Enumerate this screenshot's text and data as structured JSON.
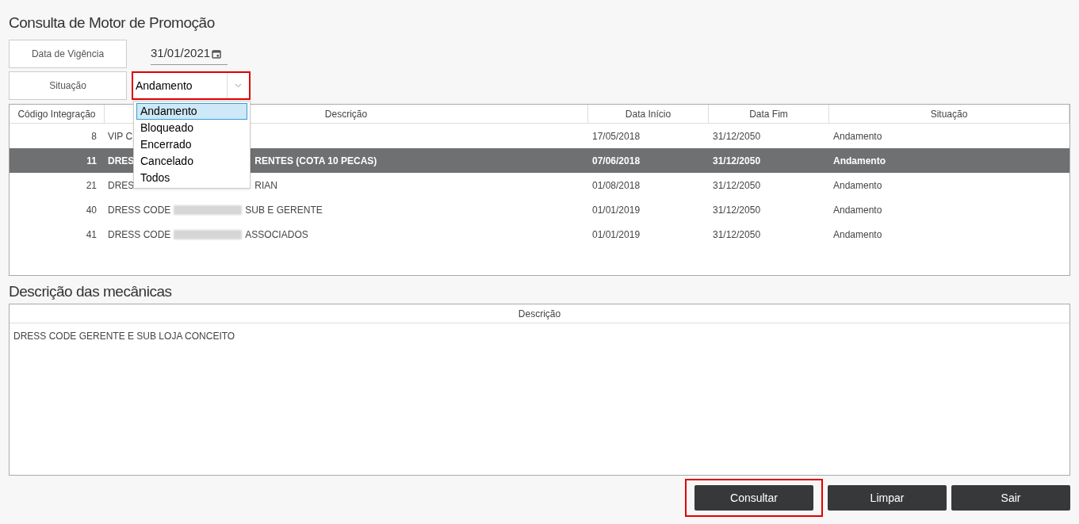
{
  "title": "Consulta de Motor de Promoção",
  "filters": {
    "date_label": "Data de Vigência",
    "date_value": "31/01/2021",
    "status_label": "Situação",
    "status_value": "Andamento",
    "highlighted": true,
    "options": [
      {
        "label": "Andamento",
        "selected": true
      },
      {
        "label": "Bloqueado",
        "selected": false
      },
      {
        "label": "Encerrado",
        "selected": false
      },
      {
        "label": "Cancelado",
        "selected": false
      },
      {
        "label": "Todos",
        "selected": false
      }
    ]
  },
  "table": {
    "columns": [
      "Código Integração",
      "Descrição",
      "Data Início",
      "Data Fim",
      "Situação"
    ],
    "rows": [
      {
        "code": "8",
        "description": [
          {
            "kind": "text",
            "text": "VIP C"
          }
        ],
        "start": "17/05/2018",
        "end": "31/12/2050",
        "status": "Andamento",
        "selected": false
      },
      {
        "code": "11",
        "description": [
          {
            "kind": "text",
            "text": "DRES"
          },
          {
            "kind": "hidden"
          },
          {
            "kind": "text",
            "text": "RENTES (COTA 10 PECAS)"
          }
        ],
        "start": "07/06/2018",
        "end": "31/12/2050",
        "status": "Andamento",
        "selected": true
      },
      {
        "code": "21",
        "description": [
          {
            "kind": "text",
            "text": "DRES"
          },
          {
            "kind": "hidden"
          },
          {
            "kind": "text",
            "text": "RIAN"
          }
        ],
        "start": "01/08/2018",
        "end": "31/12/2050",
        "status": "Andamento",
        "selected": false
      },
      {
        "code": "40",
        "description": [
          {
            "kind": "text",
            "text": "DRESS CODE"
          },
          {
            "kind": "redacted"
          },
          {
            "kind": "text",
            "text": "SUB E GERENTE"
          }
        ],
        "start": "01/01/2019",
        "end": "31/12/2050",
        "status": "Andamento",
        "selected": false
      },
      {
        "code": "41",
        "description": [
          {
            "kind": "text",
            "text": "DRESS CODE"
          },
          {
            "kind": "redacted"
          },
          {
            "kind": "text",
            "text": "ASSOCIADOS"
          }
        ],
        "start": "01/01/2019",
        "end": "31/12/2050",
        "status": "Andamento",
        "selected": false
      }
    ]
  },
  "mechanics": {
    "title": "Descrição das mecânicas",
    "column": "Descrição",
    "rows": [
      "DRESS CODE GERENTE E SUB LOJA CONCEITO"
    ]
  },
  "buttons": [
    {
      "label": "Consultar",
      "highlighted": true
    },
    {
      "label": "Limpar",
      "highlighted": false
    },
    {
      "label": "Sair",
      "highlighted": false
    }
  ]
}
